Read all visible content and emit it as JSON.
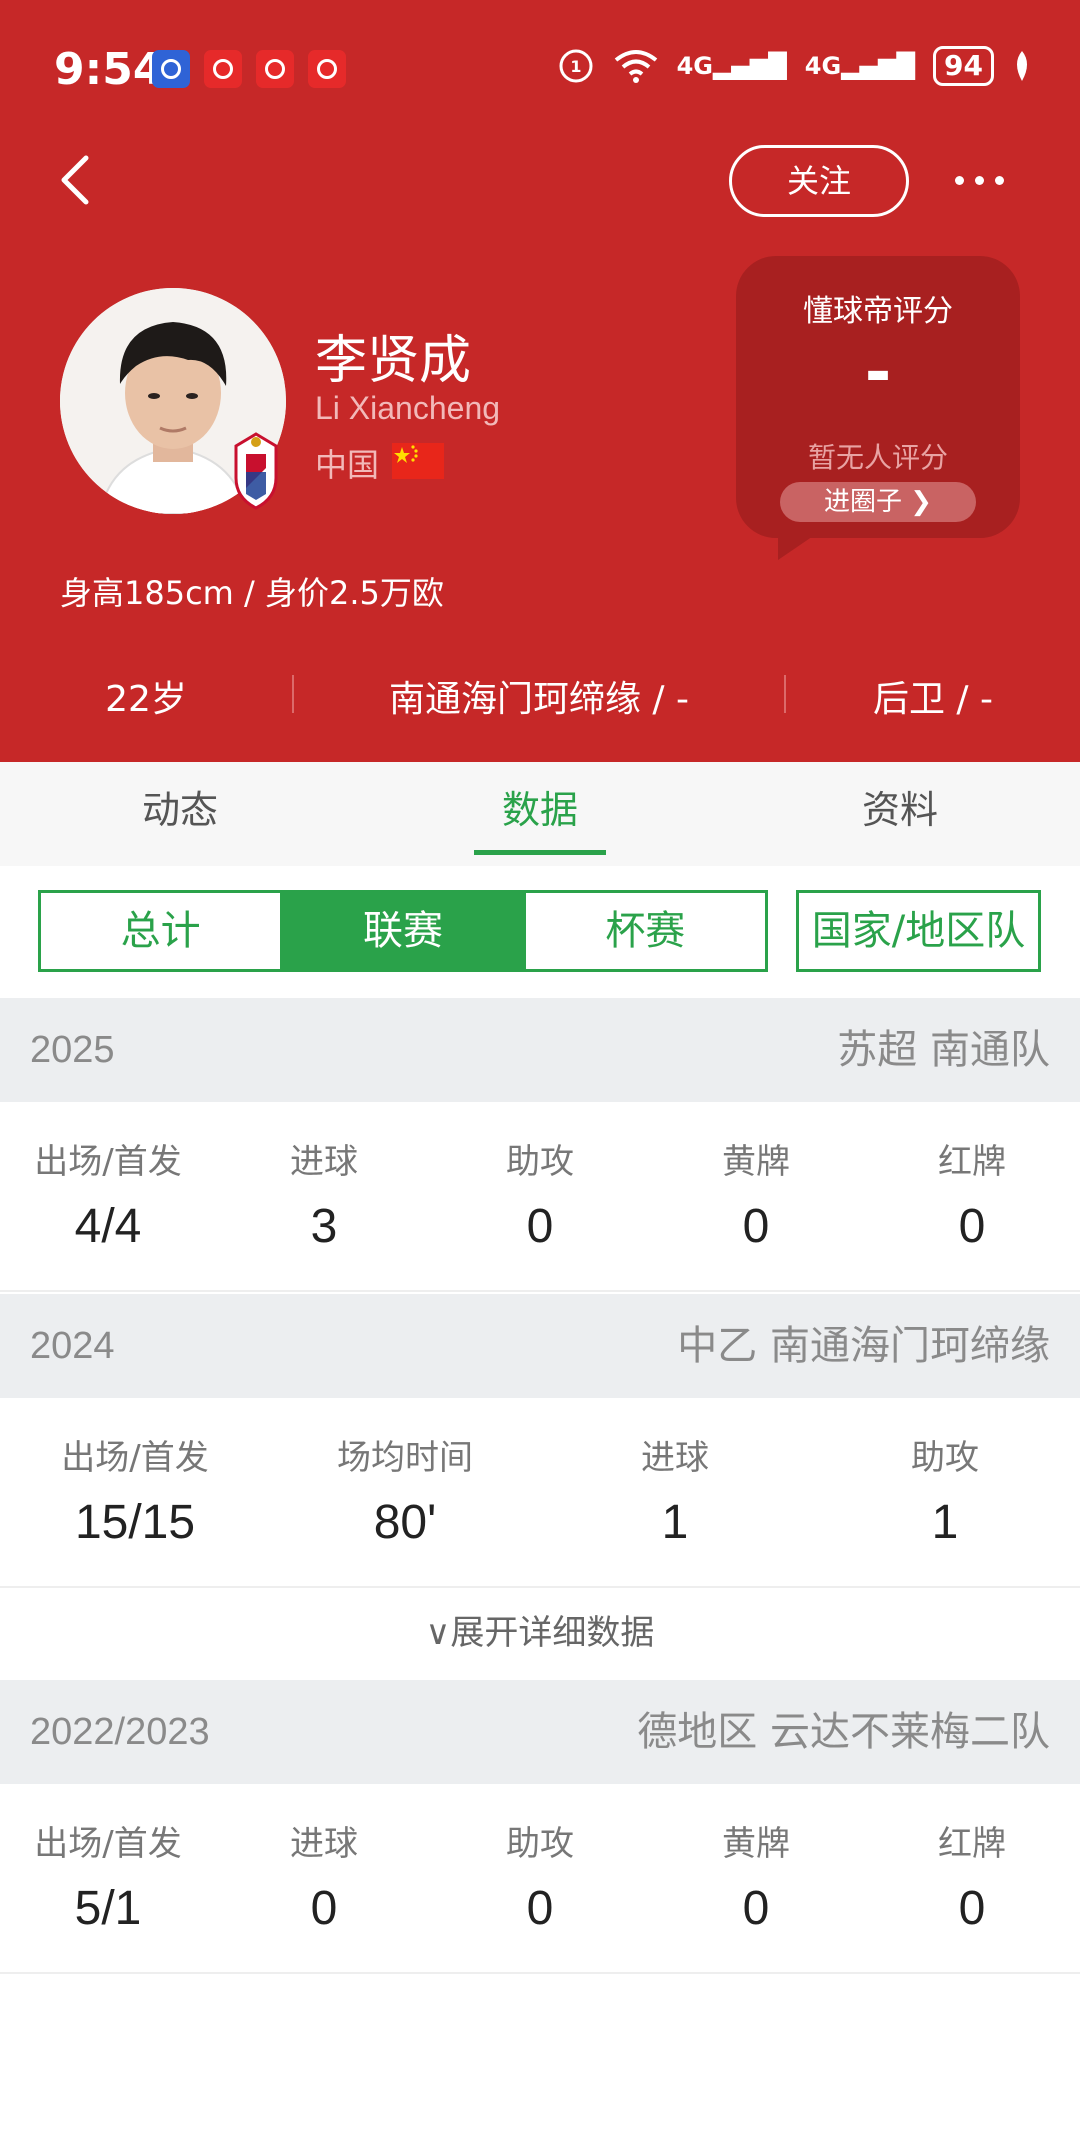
{
  "status_bar": {
    "time": "9:54",
    "network_1": "4G",
    "network_2": "4G",
    "battery": "94"
  },
  "header": {
    "follow_label": "关注",
    "player": {
      "name": "李贤成",
      "english_name": "Li Xiancheng",
      "nationality": "中国",
      "body_info": "身高185cm / 身价2.5万欧"
    },
    "rating": {
      "title": "懂球帝评分",
      "value": "-",
      "note": "暂无人评分",
      "circle_button": "进圈子 ❯"
    },
    "summary": {
      "age": "22岁",
      "club": "南通海门珂缔缘 / -",
      "position": "后卫 / -"
    }
  },
  "tabs": [
    {
      "label": "动态",
      "active": false
    },
    {
      "label": "数据",
      "active": true
    },
    {
      "label": "资料",
      "active": false
    }
  ],
  "segments": {
    "items": [
      {
        "label": "总计",
        "active": false
      },
      {
        "label": "联赛",
        "active": true
      },
      {
        "label": "杯赛",
        "active": false
      }
    ],
    "country_label": "国家/地区队"
  },
  "seasons": [
    {
      "year": "2025",
      "league": "苏超 南通队",
      "stats": [
        {
          "label": "出场/首发",
          "value": "4/4"
        },
        {
          "label": "进球",
          "value": "3"
        },
        {
          "label": "助攻",
          "value": "0"
        },
        {
          "label": "黄牌",
          "value": "0"
        },
        {
          "label": "红牌",
          "value": "0"
        }
      ]
    },
    {
      "year": "2024",
      "league": "中乙 南通海门珂缔缘",
      "stats": [
        {
          "label": "出场/首发",
          "value": "15/15"
        },
        {
          "label": "场均时间",
          "value": "80'"
        },
        {
          "label": "进球",
          "value": "1"
        },
        {
          "label": "助攻",
          "value": "1"
        }
      ],
      "expand_label": "∨展开详细数据"
    },
    {
      "year": "2022/2023",
      "league": "德地区 云达不莱梅二队",
      "stats": [
        {
          "label": "出场/首发",
          "value": "5/1"
        },
        {
          "label": "进球",
          "value": "0"
        },
        {
          "label": "助攻",
          "value": "0"
        },
        {
          "label": "黄牌",
          "value": "0"
        },
        {
          "label": "红牌",
          "value": "0"
        }
      ]
    }
  ],
  "colors": {
    "header_red": "#c62828",
    "accent_green": "#2aa24a"
  }
}
